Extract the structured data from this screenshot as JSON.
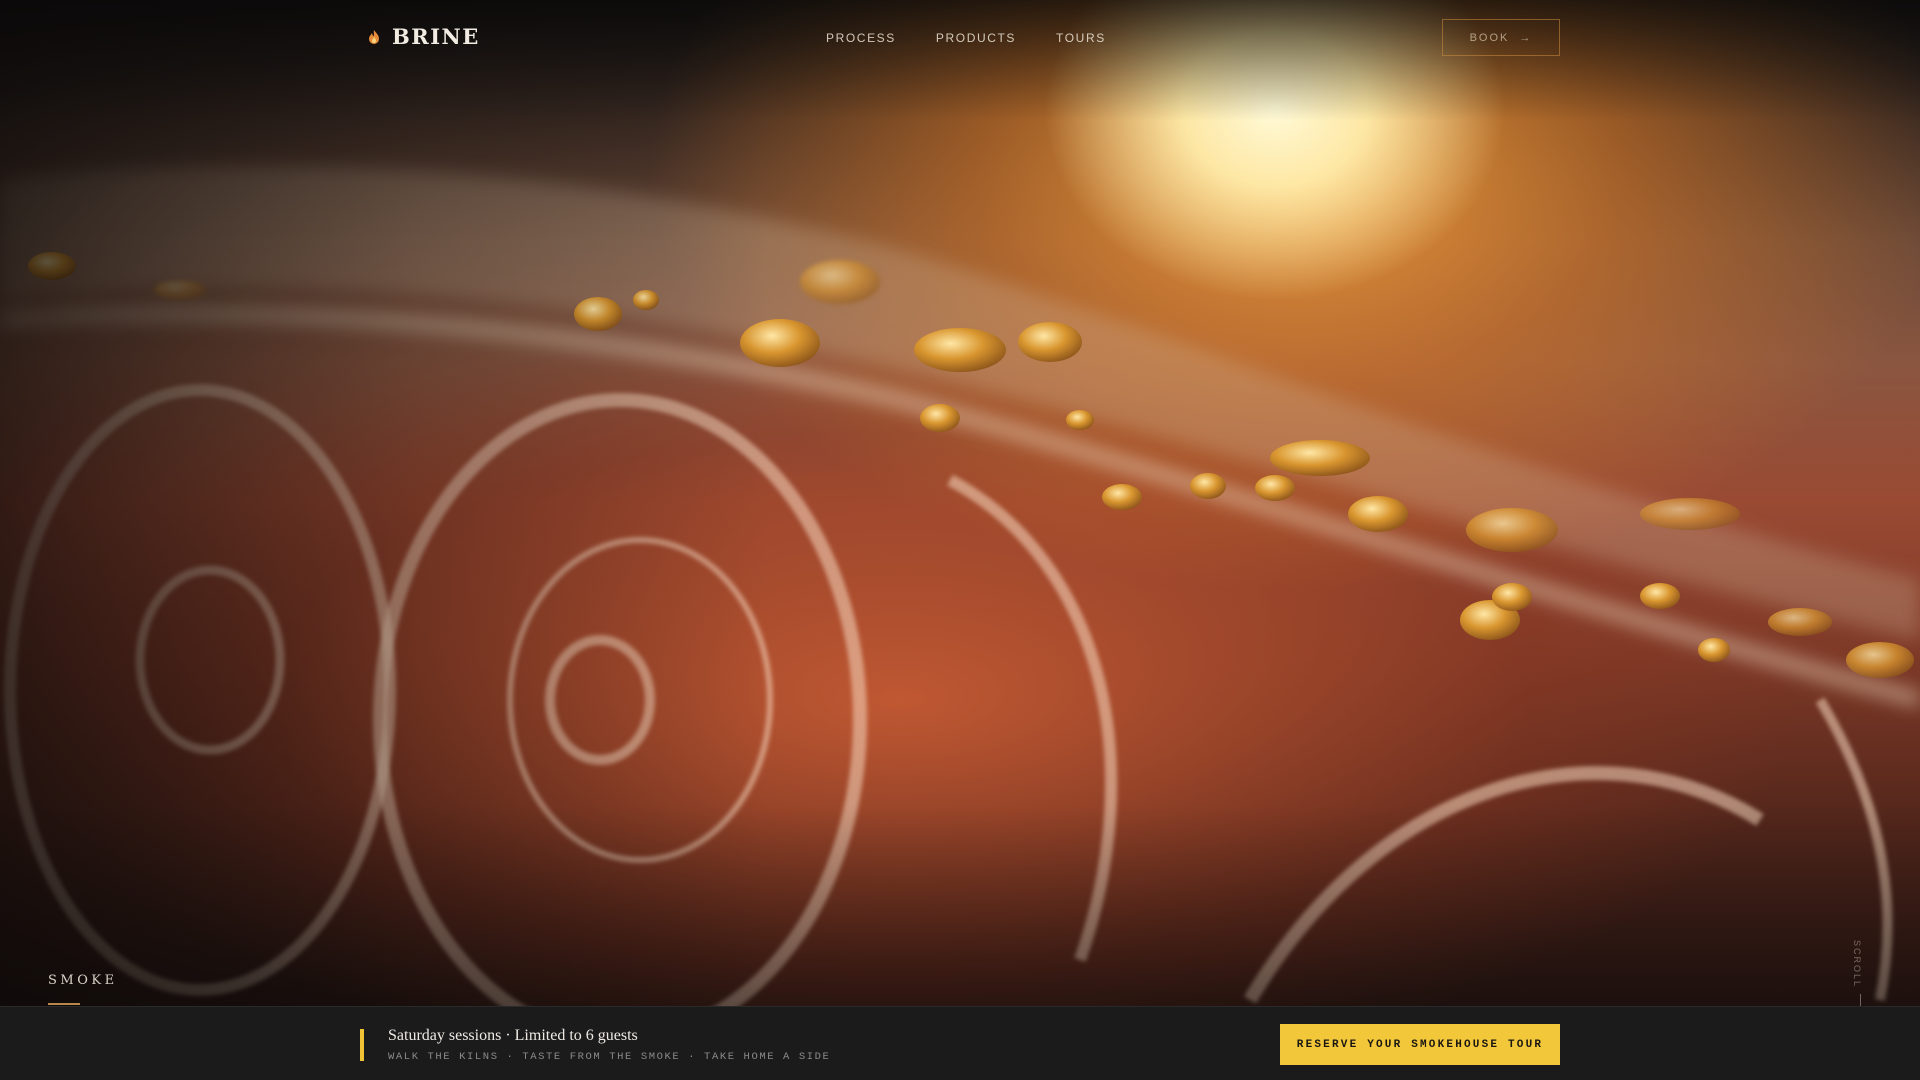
{
  "brand": {
    "name": "BRINE",
    "icon": "flame-icon"
  },
  "nav": {
    "items": [
      {
        "label": "PROCESS"
      },
      {
        "label": "PRODUCTS"
      },
      {
        "label": "TOURS"
      }
    ]
  },
  "header": {
    "book_label": "BOOK",
    "book_icon": "arrow-right-icon"
  },
  "hero": {
    "section_label": "SMOKE",
    "scroll_label": "SCROLL",
    "image": "salmon-fillet-closeup-photo"
  },
  "bottom_bar": {
    "title": "Saturday sessions · Limited to 6 guests",
    "subtitle": "WALK THE KILNS · TASTE FROM THE SMOKE · TAKE HOME A SIDE",
    "cta_label": "RESERVE YOUR SMOKEHOUSE TOUR"
  },
  "colors": {
    "accent": "#f2c73a",
    "bar_background": "#1b1b1c",
    "underline": "#b9874d"
  }
}
